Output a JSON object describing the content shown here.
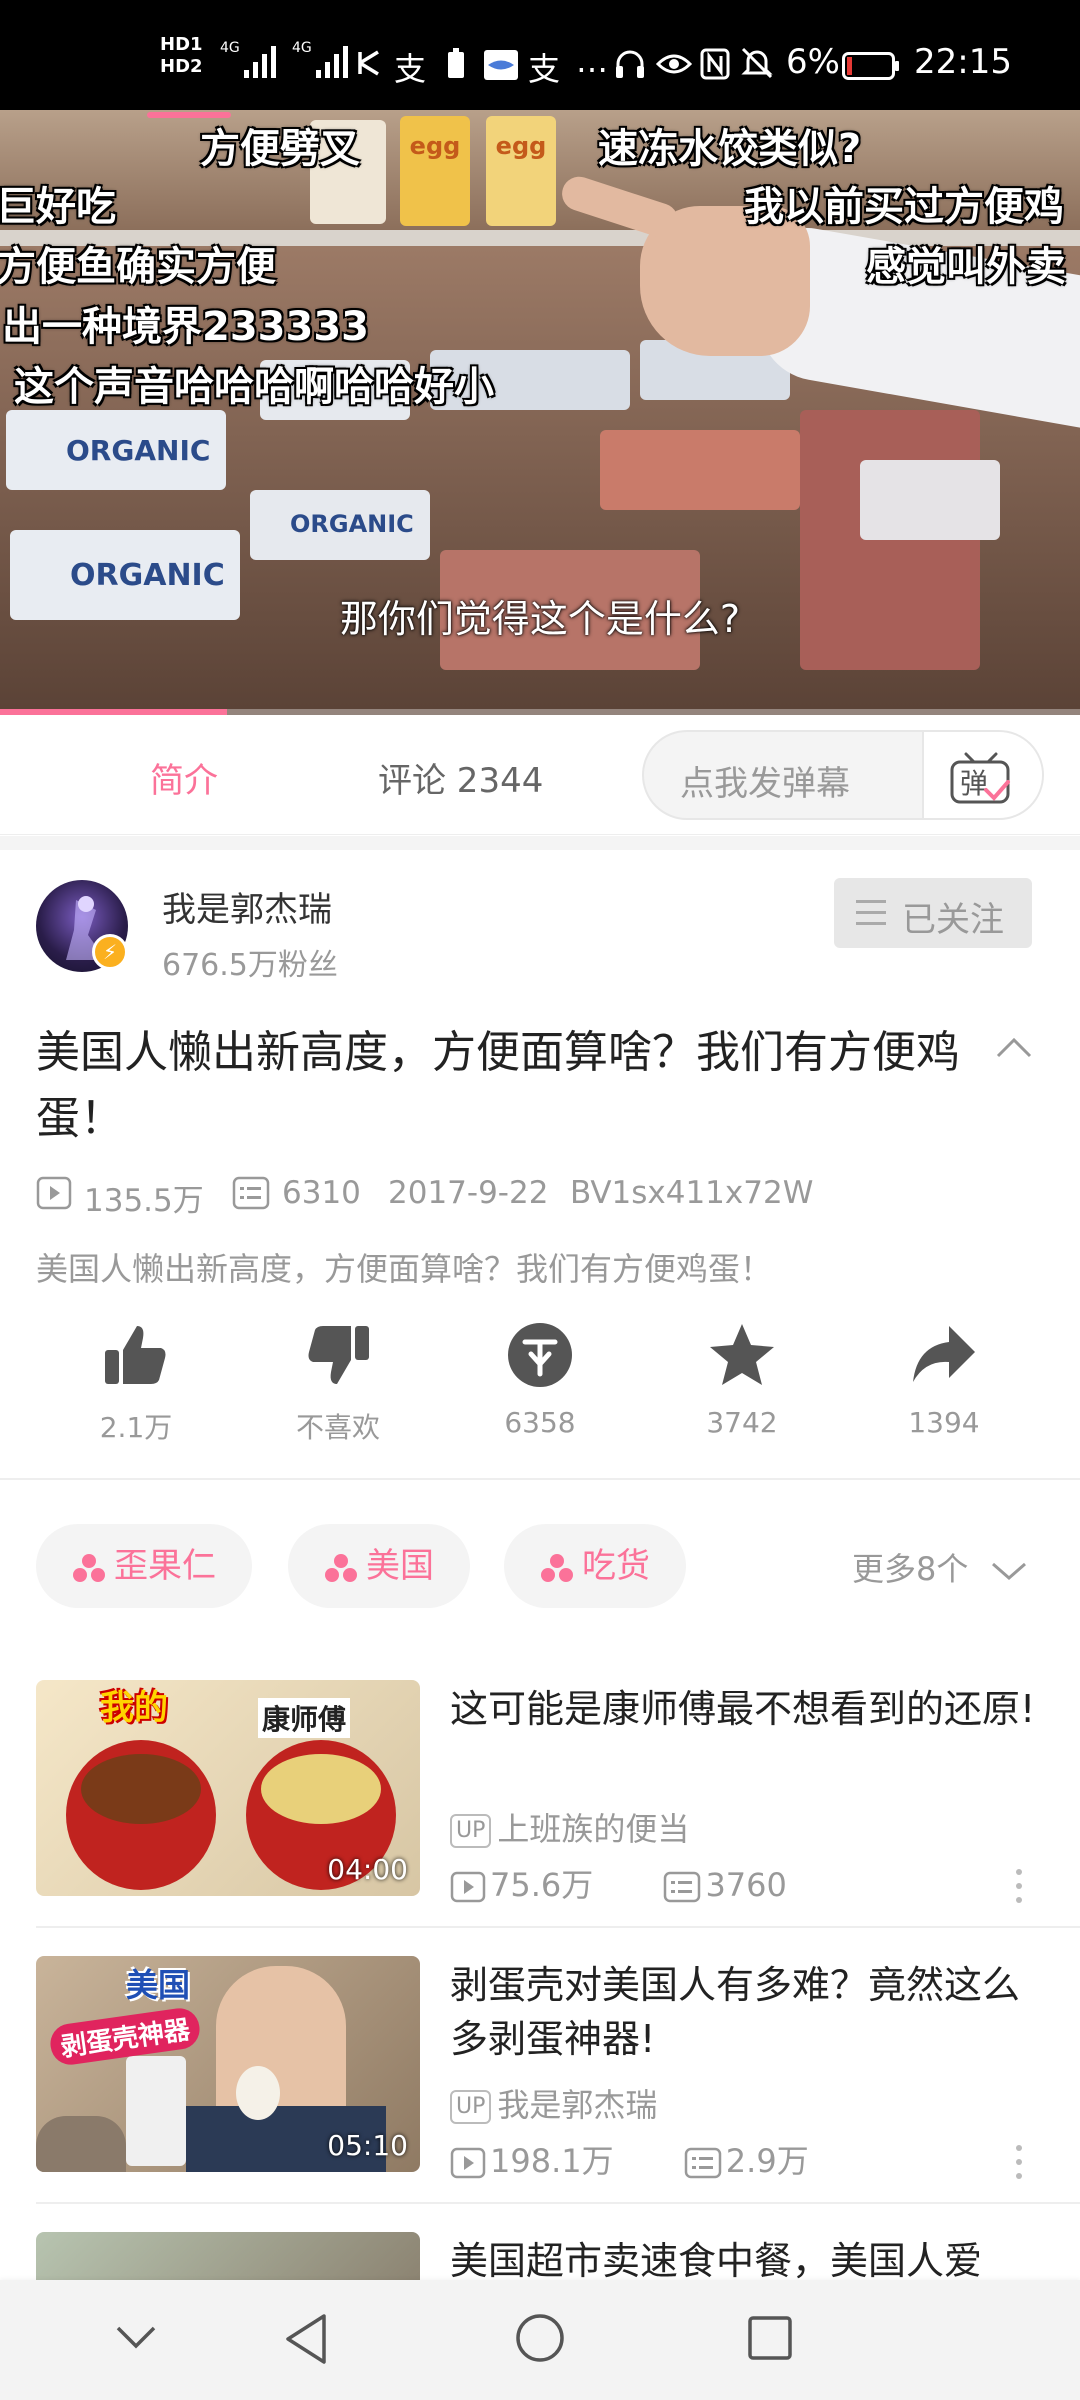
{
  "status_bar": {
    "battery_percent": "6%",
    "time": "22:15",
    "hd1": "HD1",
    "hd2": "HD2",
    "net1": "4G",
    "net2": "4G"
  },
  "video": {
    "subtitle": "那你们觉得这个是什么?",
    "progress_fraction": 0.21,
    "danmaku": [
      "方便劈叉",
      "速冻水饺类似?",
      "巨好吃",
      "我以前买过方便鸡",
      "方便鱼确实方便",
      "感觉叫外卖",
      "出一种境界233333",
      "这个声音哈哈哈啊哈哈好小"
    ],
    "shelf_label_organic": "ORGANIC",
    "shelf_label_egg": "egg"
  },
  "tabs": {
    "intro_label": "简介",
    "comments_label": "评论 2344"
  },
  "danmu_input": {
    "placeholder": "点我发弹幕",
    "button_label": "弹"
  },
  "uploader": {
    "name": "我是郭杰瑞",
    "fans": "676.5万粉丝",
    "follow_label": "已关注"
  },
  "title": "美国人懒出新高度，方便面算啥？我们有方便鸡蛋！",
  "meta": {
    "views": "135.5万",
    "danmaku_count": "6310",
    "date": "2017-9-22",
    "bvid": "BV1sx411x72W"
  },
  "description": "美国人懒出新高度，方便面算啥？我们有方便鸡蛋！",
  "actions": {
    "like": "2.1万",
    "dislike": "不喜欢",
    "coin": "6358",
    "favorite": "3742",
    "share": "1394"
  },
  "tags": [
    "歪果仁",
    "美国",
    "吃货"
  ],
  "more_tags": "更多8个",
  "recommendations": [
    {
      "title": "这可能是康师傅最不想看到的还原!",
      "uploader": "上班族的便当",
      "views": "75.6万",
      "danmaku": "3760",
      "duration": "04:00",
      "thumb_text_1": "我的",
      "thumb_text_2": "康师傅"
    },
    {
      "title": "剥蛋壳对美国人有多难？竟然这么多剥蛋神器!",
      "uploader": "我是郭杰瑞",
      "views": "198.1万",
      "danmaku": "2.9万",
      "duration": "05:10",
      "thumb_text_1": "美国",
      "thumb_text_2": "剥蛋壳神器"
    },
    {
      "title": "美国超市卖速食中餐，美国人爱"
    }
  ],
  "up_badge": "UP",
  "colors": {
    "accent": "#fb7299",
    "text_secondary": "#999999",
    "status_bar": "#000000"
  }
}
